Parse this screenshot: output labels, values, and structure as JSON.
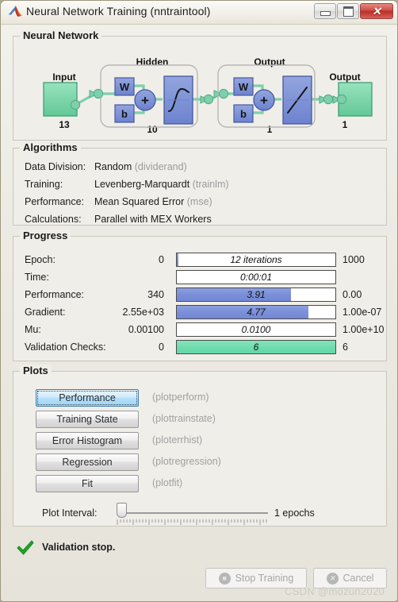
{
  "window": {
    "title": "Neural Network Training (nntraintool)",
    "icon": "matlab-membrane-icon",
    "controls": {
      "minimize": "minimize",
      "maximize": "maximize",
      "close": "close"
    }
  },
  "neural_network": {
    "legend": "Neural Network",
    "input": {
      "label": "Input",
      "size": "13"
    },
    "hidden": {
      "label": "Hidden",
      "size": "10",
      "weight": "W",
      "bias": "b",
      "sum": "+",
      "transfer": "sigmoid"
    },
    "output_layer": {
      "label": "Output",
      "size": "1",
      "weight": "W",
      "bias": "b",
      "sum": "+",
      "transfer": "linear"
    },
    "output": {
      "label": "Output",
      "size": "1"
    }
  },
  "algorithms": {
    "legend": "Algorithms",
    "rows": [
      {
        "key": "Data Division:",
        "value": "Random",
        "fn": "(dividerand)"
      },
      {
        "key": "Training:",
        "value": "Levenberg-Marquardt",
        "fn": "(trainlm)"
      },
      {
        "key": "Performance:",
        "value": "Mean Squared Error",
        "fn": "(mse)"
      },
      {
        "key": "Calculations:",
        "value": "Parallel with MEX Workers",
        "fn": ""
      }
    ]
  },
  "progress": {
    "legend": "Progress",
    "rows": [
      {
        "name": "Epoch:",
        "left": "0",
        "bar": "12 iterations",
        "right": "1000",
        "fill": 1,
        "color": "blue"
      },
      {
        "name": "Time:",
        "left": "",
        "bar": "0:00:01",
        "right": "",
        "fill": 0,
        "color": "blue"
      },
      {
        "name": "Performance:",
        "left": "340",
        "bar": "3.91",
        "right": "0.00",
        "fill": 72,
        "color": "blue"
      },
      {
        "name": "Gradient:",
        "left": "2.55e+03",
        "bar": "4.77",
        "right": "1.00e-07",
        "fill": 83,
        "color": "blue"
      },
      {
        "name": "Mu:",
        "left": "0.00100",
        "bar": "0.0100",
        "right": "1.00e+10",
        "fill": 0,
        "color": "blue"
      },
      {
        "name": "Validation Checks:",
        "left": "0",
        "bar": "6",
        "right": "6",
        "fill": 100,
        "color": "green"
      }
    ]
  },
  "plots": {
    "legend": "Plots",
    "buttons": [
      {
        "label": "Performance",
        "fn": "(plotperform)",
        "focused": true
      },
      {
        "label": "Training State",
        "fn": "(plottrainstate)",
        "focused": false
      },
      {
        "label": "Error Histogram",
        "fn": "(ploterrhist)",
        "focused": false
      },
      {
        "label": "Regression",
        "fn": "(plotregression)",
        "focused": false
      },
      {
        "label": "Fit",
        "fn": "(plotfit)",
        "focused": false
      }
    ],
    "interval_label": "Plot Interval:",
    "interval_value": "1 epochs",
    "interval_position": 0
  },
  "status": {
    "icon": "green-check-icon",
    "message": "Validation stop.",
    "stop_button": "Stop Training",
    "cancel_button": "Cancel"
  },
  "watermark": "CSDN @mozun2020",
  "colors": {
    "bar_blue": "#7b8fd8",
    "bar_green": "#6fdcae",
    "node_green": "#7fd8ab",
    "block_blue": "#7e92d6",
    "accent_focus": "#3c7fb1"
  }
}
